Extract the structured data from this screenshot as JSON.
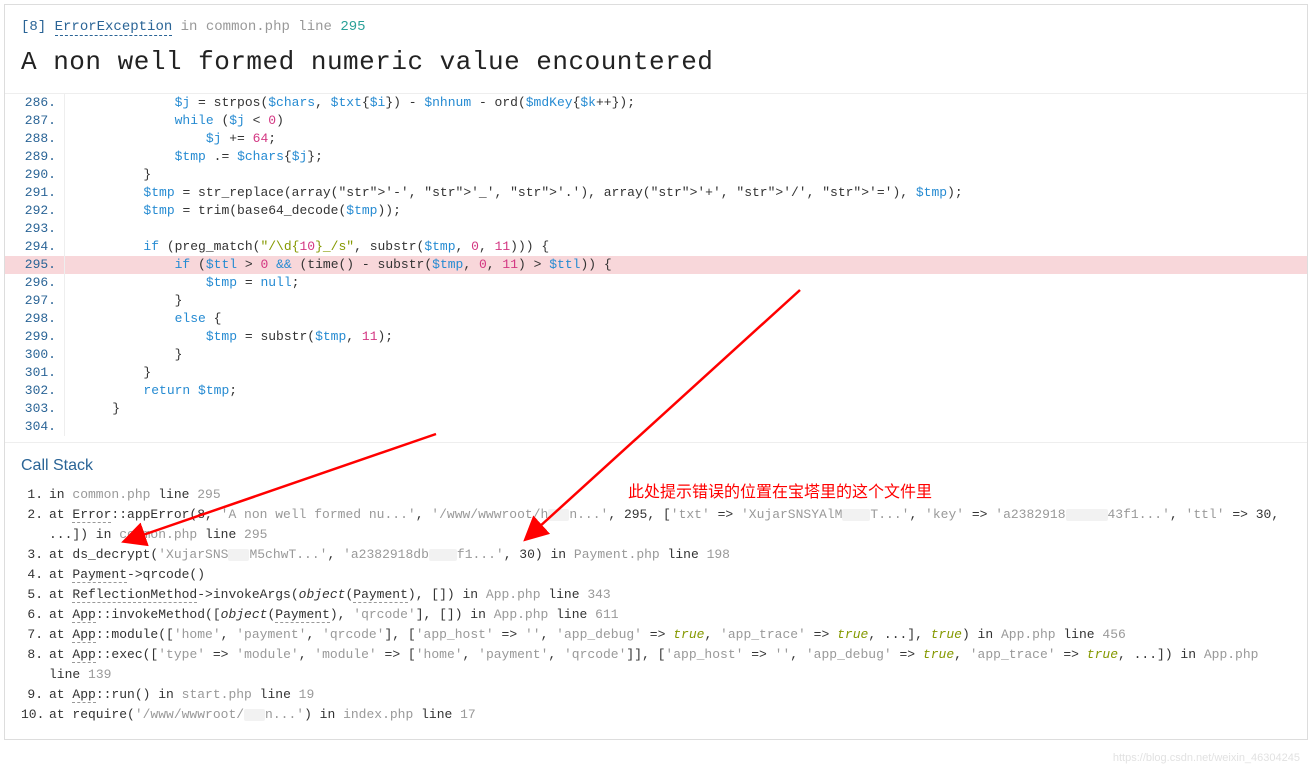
{
  "header": {
    "errno": "[8]",
    "exception": "ErrorException",
    "in": "in",
    "file": "common.php",
    "line_word": "line",
    "line": "295"
  },
  "title": "A non well formed numeric value encountered",
  "code": [
    {
      "n": "286.",
      "html": "            $j = strpos($chars, $txt{$i}) - $nhnum - ord($mdKey{$k++});"
    },
    {
      "n": "287.",
      "html": "            while ($j < 0)"
    },
    {
      "n": "288.",
      "html": "                $j += 64;"
    },
    {
      "n": "289.",
      "html": "            $tmp .= $chars{$j};"
    },
    {
      "n": "290.",
      "html": "        }"
    },
    {
      "n": "291.",
      "html": "        $tmp = str_replace(array('-', '_', '.'), array('+', '/', '='), $tmp);"
    },
    {
      "n": "292.",
      "html": "        $tmp = trim(base64_decode($tmp));"
    },
    {
      "n": "293.",
      "html": ""
    },
    {
      "n": "294.",
      "html": "        if (preg_match(\"/\\d{10}_/s\", substr($tmp, 0, 11))) {"
    },
    {
      "n": "295.",
      "html": "            if ($ttl > 0 && (time() - substr($tmp, 0, 11) > $ttl)) {",
      "hl": true
    },
    {
      "n": "296.",
      "html": "                $tmp = null;"
    },
    {
      "n": "297.",
      "html": "            }"
    },
    {
      "n": "298.",
      "html": "            else {"
    },
    {
      "n": "299.",
      "html": "                $tmp = substr($tmp, 11);"
    },
    {
      "n": "300.",
      "html": "            }"
    },
    {
      "n": "301.",
      "html": "        }"
    },
    {
      "n": "302.",
      "html": "        return $tmp;"
    },
    {
      "n": "303.",
      "html": "    }"
    },
    {
      "n": "304.",
      "html": ""
    }
  ],
  "callstack_title": "Call Stack",
  "stack": [
    {
      "n": "1.",
      "text": "in common.php line 295"
    },
    {
      "n": "2.",
      "text": "at Error::appError(8, 'A non well formed nu...', '/www/wwwroot/h███n...', 295, ['txt' => 'XujarSNSYAlM████T...', 'key' => 'a2382918██████43f1...', 'ttl' => 30, ...]) in common.php line 295"
    },
    {
      "n": "3.",
      "text": "at ds_decrypt('XujarSNS███M5chwT...', 'a2382918db████f1...', 30) in Payment.php line 198"
    },
    {
      "n": "4.",
      "text": "at Payment->qrcode()"
    },
    {
      "n": "5.",
      "text": "at ReflectionMethod->invokeArgs(object(Payment), []) in App.php line 343"
    },
    {
      "n": "6.",
      "text": "at App::invokeMethod([object(Payment), 'qrcode'], []) in App.php line 611"
    },
    {
      "n": "7.",
      "text": "at App::module(['home', 'payment', 'qrcode'], ['app_host' => '', 'app_debug' => true, 'app_trace' => true, ...], true) in App.php line 456"
    },
    {
      "n": "8.",
      "text": "at App::exec(['type' => 'module', 'module' => ['home', 'payment', 'qrcode']], ['app_host' => '', 'app_debug' => true, 'app_trace' => true, ...]) in App.php line 139"
    },
    {
      "n": "9.",
      "text": "at App::run() in start.php line 19"
    },
    {
      "n": "10.",
      "text": "at require('/www/wwwroot/███n...') in index.php line 17"
    }
  ],
  "annotation": "此处提示错误的位置在宝塔里的这个文件里",
  "watermark": "https://blog.csdn.net/weixin_46304245"
}
